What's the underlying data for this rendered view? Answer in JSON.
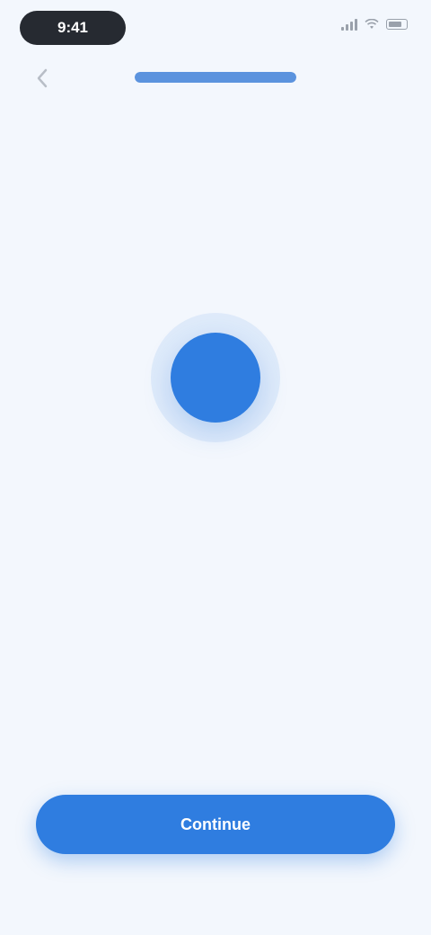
{
  "status_bar": {
    "time": "9:41",
    "icons": [
      "signal-icon",
      "wifi-icon",
      "battery-icon"
    ]
  },
  "header": {
    "back_icon": "chevron-left-icon",
    "progress_fraction": 1.0
  },
  "hero": {
    "icon": "check-icon",
    "accent_color": "#2f7de0"
  },
  "content": {
    "title": "",
    "subtitle": ""
  },
  "footer": {
    "button_label": "Continue"
  }
}
